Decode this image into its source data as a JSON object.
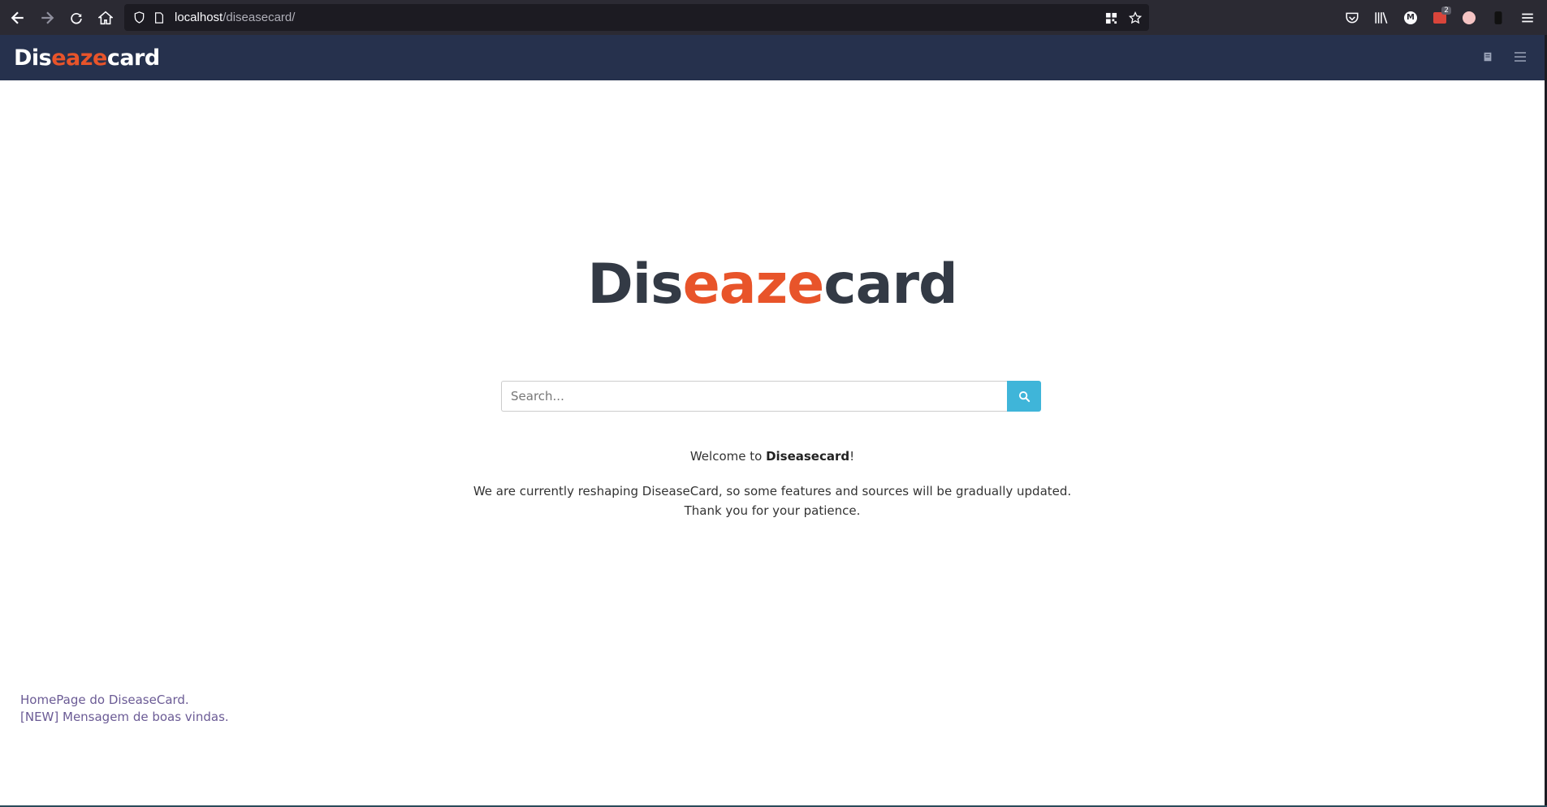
{
  "browser": {
    "url_host": "localhost",
    "url_path": "/diseasecard/",
    "extension_badge_count": "2",
    "m_letter": "M"
  },
  "site": {
    "logo": {
      "part1": "Dis",
      "part2": "eaze",
      "part3": "card"
    },
    "colors": {
      "navbar": "#26314d",
      "accent": "#e8542a",
      "search_button": "#3fb5d9"
    }
  },
  "hero": {
    "logo": {
      "part1": "Dis",
      "part2": "eaze",
      "part3": "card"
    }
  },
  "search": {
    "placeholder": "Search..."
  },
  "welcome": {
    "prefix": "Welcome to ",
    "brand": "Diseasecard",
    "suffix": "!"
  },
  "notice": {
    "line1": "We are currently reshaping DiseaseCard, so some features and sources will be gradually updated.",
    "line2": "Thank you for your patience."
  },
  "news": [
    "HomePage do DiseaseCard.",
    "[NEW] Mensagem de boas vindas."
  ]
}
